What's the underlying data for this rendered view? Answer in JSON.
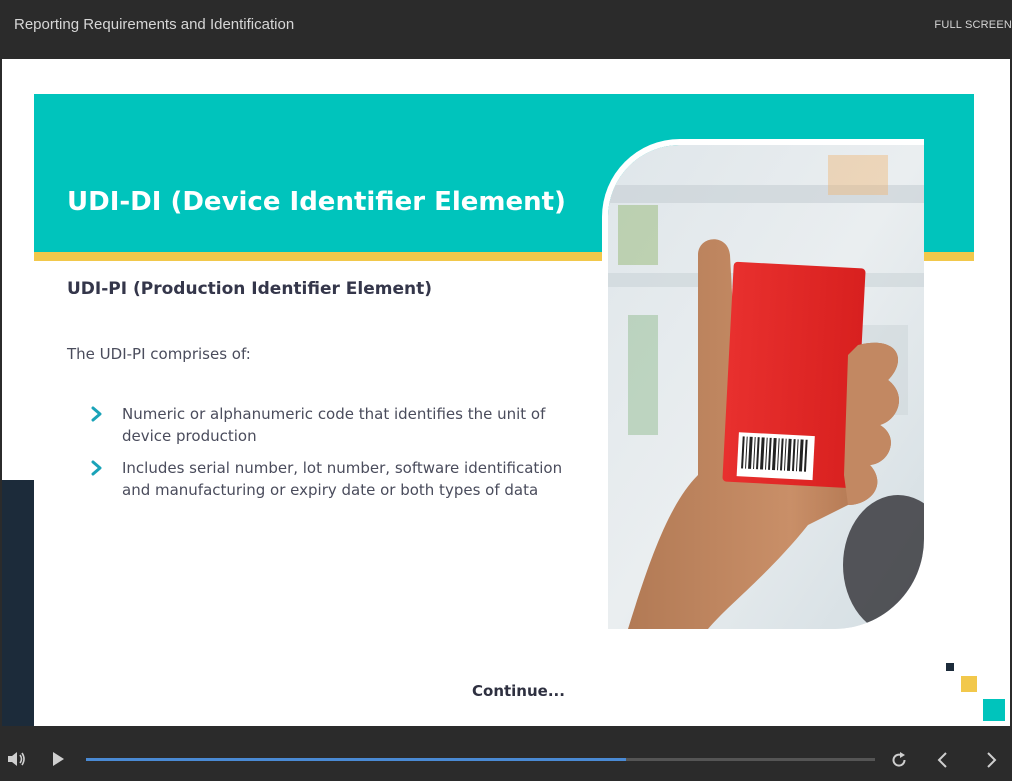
{
  "header": {
    "course_title": "Reporting Requirements and Identification",
    "fullscreen_label": "FULL SCREEN"
  },
  "slide": {
    "banner_title": "UDI-DI (Device Identifier Element)",
    "sub_heading": "UDI-PI (Production Identifier Element)",
    "intro": "The UDI-PI comprises of:",
    "bullets": [
      "Numeric or alphanumeric code that identifies the unit of device production",
      "Includes serial number, lot number, software identification and manufacturing or expiry date or both types of data"
    ],
    "continue_label": "Continue..."
  },
  "player": {
    "progress": 0.685
  },
  "colors": {
    "teal": "#00c4bc",
    "yellow": "#f2c84b",
    "navy": "#1c2b3a",
    "progress": "#4a8ad4"
  },
  "icons": {
    "bullet": "chevron-right-icon",
    "volume": "volume-icon",
    "play": "play-icon",
    "replay": "replay-icon",
    "prev": "chevron-left-icon",
    "next": "chevron-right-icon"
  }
}
